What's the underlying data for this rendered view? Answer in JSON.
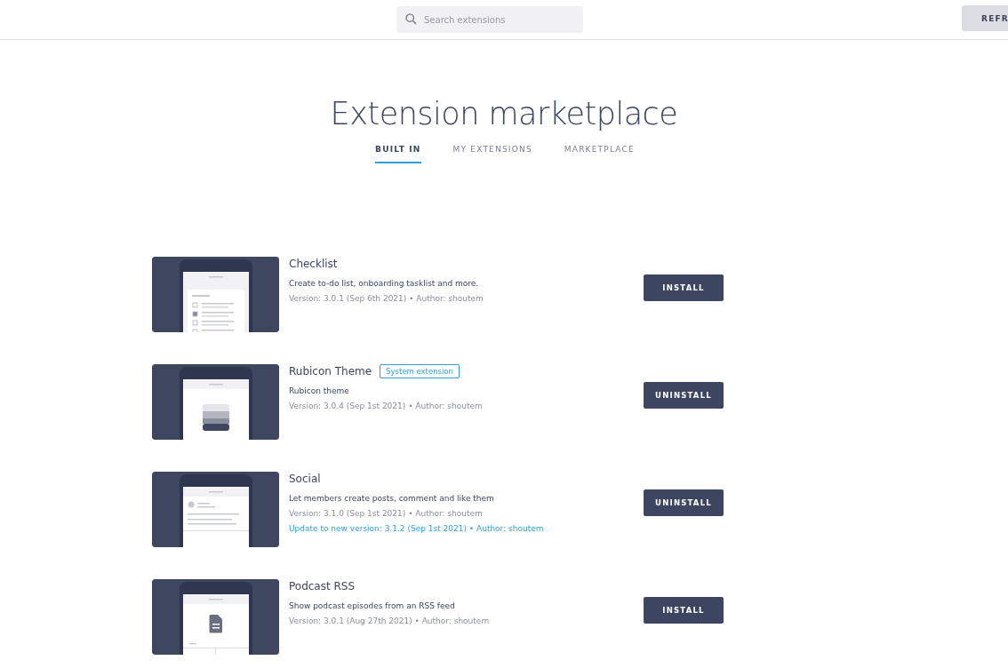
{
  "search": {
    "placeholder": "Search extensions"
  },
  "refresh_button": {
    "label": "REFR"
  },
  "title": "Extension marketplace",
  "tabs": [
    {
      "label": "BUILT IN",
      "selected": true
    },
    {
      "label": "MY EXTENSIONS",
      "selected": false
    },
    {
      "label": "MARKETPLACE",
      "selected": false
    }
  ],
  "extensions": [
    {
      "name": "Checklist",
      "description": "Create to-do list, onboarding tasklist and more.",
      "version": "Version: 3.0.1 (Sep 6th 2021) • Author: shoutem",
      "action": "INSTALL"
    },
    {
      "name": "Rubicon Theme",
      "badge": "System extension",
      "description": "Rubicon theme",
      "version": "Version: 3.0.4 (Sep 1st 2021) • Author: shoutem",
      "action": "UNINSTALL"
    },
    {
      "name": "Social",
      "description": "Let members create posts, comment and like them",
      "version": "Version: 3.1.0 (Sep 1st 2021) • Author: shoutem",
      "update": "Update to new version: 3.1.2 (Sep 1st 2021) • Author: shoutem",
      "action": "UNINSTALL"
    },
    {
      "name": "Podcast RSS",
      "description": "Show podcast episodes from an RSS feed",
      "version": "Version: 3.0.1 (Aug 27th 2021) • Author: shoutem",
      "action": "INSTALL"
    }
  ]
}
